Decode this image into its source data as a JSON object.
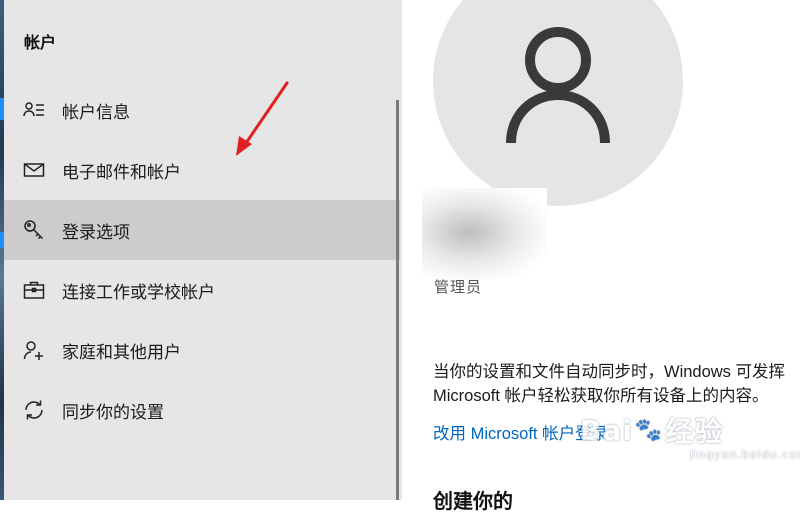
{
  "sidebar": {
    "title": "帐户",
    "items": [
      {
        "label": "帐户信息",
        "icon": "person-card-icon",
        "selected": false
      },
      {
        "label": "电子邮件和帐户",
        "icon": "mail-icon",
        "selected": false
      },
      {
        "label": "登录选项",
        "icon": "key-icon",
        "selected": true
      },
      {
        "label": "连接工作或学校帐户",
        "icon": "briefcase-icon",
        "selected": false
      },
      {
        "label": "家庭和其他用户",
        "icon": "person-add-icon",
        "selected": false
      },
      {
        "label": "同步你的设置",
        "icon": "sync-icon",
        "selected": false
      }
    ]
  },
  "main": {
    "role": "管理员",
    "description_line1": "当你的设置和文件自动同步时，Windows 可发挥",
    "description_line2": "Microsoft 帐户轻松获取你所有设备上的内容。",
    "link": "改用 Microsoft 帐户登录",
    "next_heading": "创建你的"
  },
  "watermark": {
    "main_left": "Bai",
    "main_right": "经验",
    "sub": "jingyan.baidu.com"
  },
  "colors": {
    "sidebar_bg": "#e6e6e6",
    "selected_bg": "#cccccc",
    "link": "#0067c0",
    "annotation_arrow": "#e02020"
  }
}
